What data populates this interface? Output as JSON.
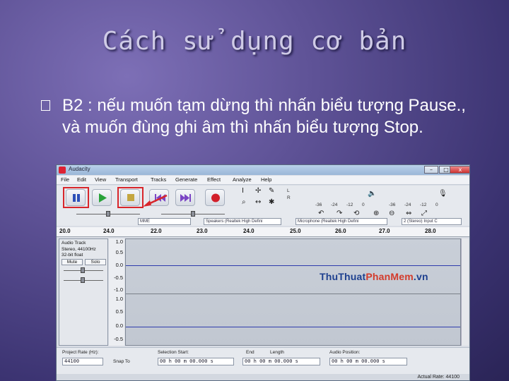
{
  "slide": {
    "title": "Cách sử dụng cơ bản",
    "bullet_text": "B2 : nếu muốn tạm dừng thì nhấn biểu tượng Pause., và muốn đùng ghi âm thì nhấn biểu tượng Stop."
  },
  "window": {
    "title": "Audacity",
    "controls": [
      "–",
      "□",
      "x"
    ]
  },
  "menu": [
    "File",
    "Edit",
    "View",
    "Transport",
    "Tracks",
    "Generate",
    "Effect",
    "Analyze",
    "Help"
  ],
  "toolbar": {
    "buttons": [
      "pause",
      "play",
      "stop",
      "skip-start",
      "skip-end",
      "record"
    ],
    "meter_labels": [
      "L",
      "R",
      "-36",
      "-24",
      "-12",
      "0",
      "-36",
      "-24",
      "-12",
      "0"
    ],
    "highlight_color": "#d8262b"
  },
  "devices": {
    "host": "MME",
    "output": "Speakers (Realtek High Defini",
    "input": "Microphone (Realtek High Defini",
    "channels": "2 (Stereo) Input C"
  },
  "ruler": [
    "20.0",
    "24.0",
    "22.0",
    "23.0",
    "24.0",
    "25.0",
    "26.0",
    "27.0",
    "28.0"
  ],
  "track": {
    "name": "Audio Track",
    "info_line1": "Stereo, 44100Hz",
    "info_line2": "32-bit float",
    "mute_label": "Mute",
    "solo_label": "Solo",
    "scale": [
      "1.0",
      "0.5",
      "0.0",
      "-0.5",
      "-1.0",
      "1.0",
      "0.5",
      "0.0",
      "-0.5"
    ]
  },
  "watermark": {
    "part1": "ThuThuat",
    "part2": "PhanMem",
    "part3": ".vn"
  },
  "bottom": {
    "project_rate_label": "Project Rate (Hz):",
    "project_rate_value": "44100",
    "snap_label": "Snap To",
    "selection_start_label": "Selection Start:",
    "end_label": "End",
    "length_label": "Length",
    "audio_position_label": "Audio Position:",
    "selection_start_value": "00 h 00 m 00.000 s",
    "end_value": "00 h 00 m 00.000 s",
    "audio_position_value": "00 h 00 m 00.000 s"
  },
  "status": {
    "actual_rate": "Actual Rate: 44100"
  }
}
